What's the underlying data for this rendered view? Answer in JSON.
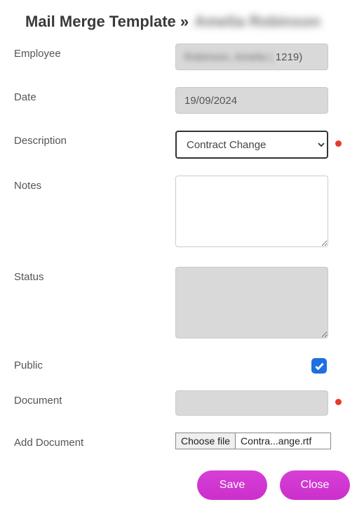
{
  "title": {
    "prefix": "Mail Merge Template »",
    "name": "Amelia Robinson"
  },
  "labels": {
    "employee": "Employee",
    "date": "Date",
    "description": "Description",
    "notes": "Notes",
    "status": "Status",
    "public": "Public",
    "document": "Document",
    "add_document": "Add Document"
  },
  "fields": {
    "employee_name_blurred": "Robinson, Amelia (",
    "employee_code_visible": "1219)",
    "date": "19/09/2024",
    "description_selected": "Contract Change",
    "notes": "",
    "status": "",
    "public_checked": true,
    "document": "",
    "file_button": "Choose file",
    "file_name": "Contra...ange.rtf"
  },
  "buttons": {
    "save": "Save",
    "close": "Close"
  }
}
